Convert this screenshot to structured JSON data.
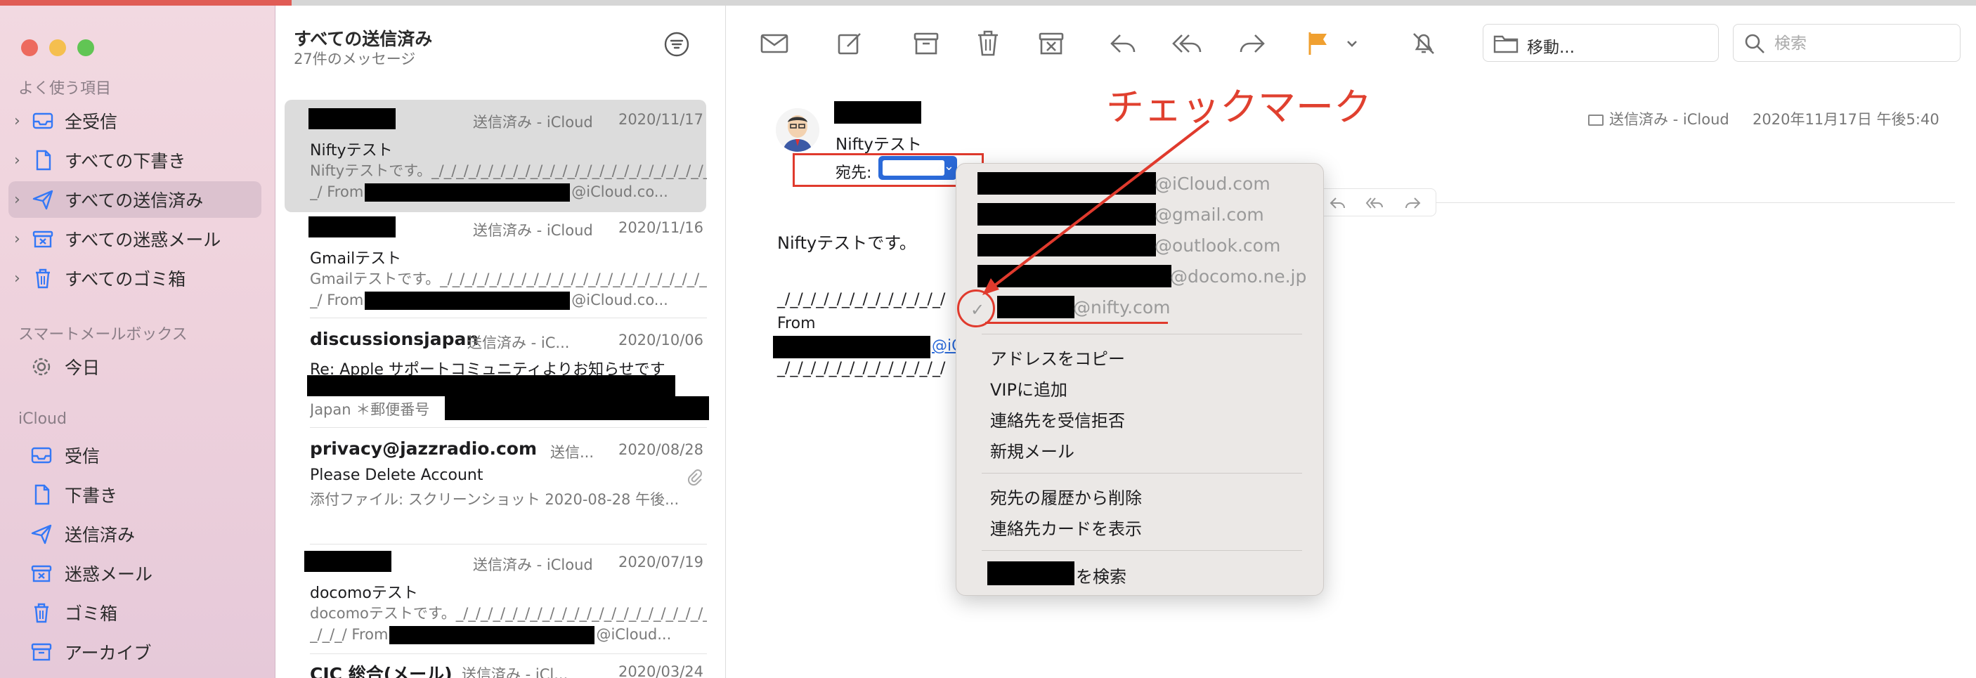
{
  "sidebar": {
    "section_favorites": "よく使う項目",
    "favorites": [
      {
        "label": "全受信",
        "icon": "inbox-icon"
      },
      {
        "label": "すべての下書き",
        "icon": "draft-icon"
      },
      {
        "label": "すべての送信済み",
        "icon": "sent-icon"
      },
      {
        "label": "すべての迷惑メール",
        "icon": "junk-icon"
      },
      {
        "label": "すべてのゴミ箱",
        "icon": "trash-icon"
      }
    ],
    "section_smart": "スマートメールボックス",
    "smart": [
      {
        "label": "今日",
        "icon": "gear-icon"
      }
    ],
    "section_icloud": "iCloud",
    "icloud": [
      {
        "label": "受信",
        "icon": "inbox-icon"
      },
      {
        "label": "下書き",
        "icon": "draft-icon"
      },
      {
        "label": "送信済み",
        "icon": "sent-icon"
      },
      {
        "label": "迷惑メール",
        "icon": "junk-icon"
      },
      {
        "label": "ゴミ箱",
        "icon": "trash-icon"
      },
      {
        "label": "アーカイブ",
        "icon": "archive-icon"
      }
    ]
  },
  "list": {
    "title": "すべての送信済み",
    "count": "27件のメッセージ",
    "messages": [
      {
        "sender": "",
        "mailbox": "送信済み - iCloud",
        "date": "2020/11/17",
        "subject": "Niftyテスト",
        "preview1": "Niftyテストです。_/_/_/_/_/_/_/_/_/_/_/_/_/_/_/_/_/_/_/_/_/_/_/",
        "preview2": "_/ From",
        "preview2_tail": "@iCloud.co..."
      },
      {
        "sender": "",
        "mailbox": "送信済み - iCloud",
        "date": "2020/11/16",
        "subject": "Gmailテスト",
        "preview1": "Gmailテストです。_/_/_/_/_/_/_/_/_/_/_/_/_/_/_/_/_/_/_/_/_/_/",
        "preview2": "_/ From",
        "preview2_tail": "@iCloud.co..."
      },
      {
        "sender": "discussionsjapan",
        "mailbox": "送信済み - iC...",
        "date": "2020/10/06",
        "subject": "Re: Apple サポートコミュニティよりお知らせです",
        "preview1": "",
        "preview2": "Japan ＊郵便番号",
        "preview2_tail": ""
      },
      {
        "sender": "privacy@jazzradio.com",
        "mailbox": "送信...",
        "date": "2020/08/28",
        "subject": "Please Delete Account",
        "preview1": "添付ファイル: スクリーンショット 2020-08-28 午後...",
        "preview2": "",
        "preview2_tail": ""
      },
      {
        "sender": "",
        "mailbox": "送信済み - iCloud",
        "date": "2020/07/19",
        "subject": "docomoテスト",
        "preview1": "docomoテストです。_/_/_/_/_/_/_/_/_/_/_/_/_/_/_/_/_/_/_/_/_/",
        "preview2": "_/_/_/ From",
        "preview2_tail": "@iCloud..."
      },
      {
        "sender": "CIC 総合(メール)",
        "mailbox": "送信済み - iCl...",
        "date": "2020/03/24",
        "subject": "",
        "preview1": "",
        "preview2": "",
        "preview2_tail": ""
      }
    ]
  },
  "toolbar": {
    "move_label": "移動...",
    "search_placeholder": "検索",
    "flag_color": "#f0a030"
  },
  "pane": {
    "subject": "Niftyテスト",
    "to_label": "宛先:",
    "mailbox": "送信済み - iCloud",
    "date": "2020年11月17日 午後5:40",
    "body_line1": "Niftyテストです。",
    "body_sig": "_/_/_/_/_/_/_/_/_/_/_/_/_/",
    "body_from": "From",
    "body_link_frag": "@iCl",
    "body_sig2": "_/_/_/_/_/_/_/_/_/_/_/_/_/"
  },
  "annotation": {
    "text": "チェックマーク",
    "color": "#e0402f"
  },
  "menu": {
    "addresses": [
      "@iCloud.com",
      "@gmail.com",
      "@outlook.com",
      "@docomo.ne.jp",
      "@nifty.com"
    ],
    "check": "✓",
    "group1": [
      "アドレスをコピー",
      "VIPに追加",
      "連絡先を受信拒否",
      "新規メール"
    ],
    "group2": [
      "宛先の履歴から削除",
      "連絡先カードを表示"
    ],
    "search_suffix": "を検索"
  }
}
